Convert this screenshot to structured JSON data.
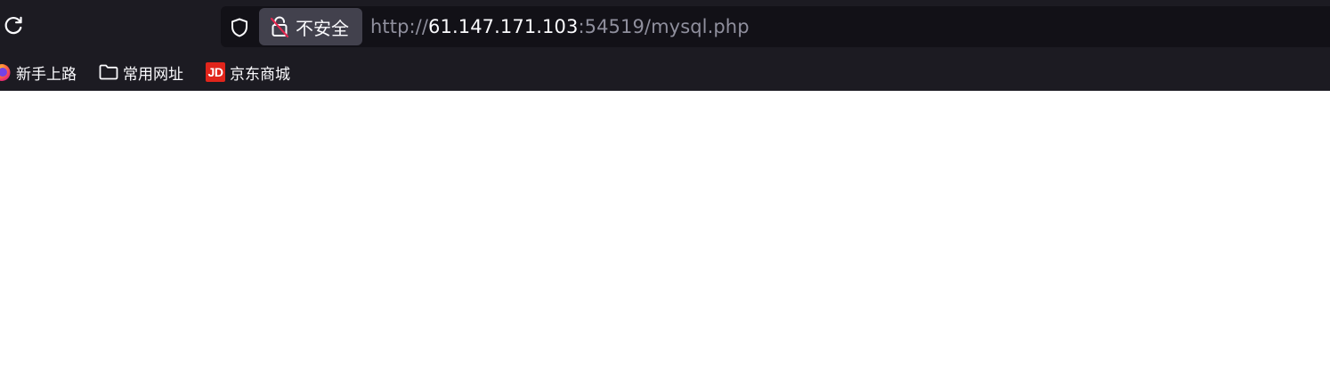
{
  "toolbar": {
    "reload_icon": "reload-icon"
  },
  "urlbar": {
    "shield_icon": "shield-icon",
    "insecure_label": "不安全",
    "insecure_icon": "insecure-lock-icon",
    "url_scheme": "http://",
    "url_host": "61.147.171.103",
    "url_rest": ":54519/mysql.php"
  },
  "bookmarks": {
    "items": [
      {
        "label": "新手上路",
        "icon": "firefox-icon"
      },
      {
        "label": "常用网址",
        "icon": "folder-icon"
      },
      {
        "label": "京东商城",
        "icon": "jd-icon",
        "logo_text": "JD"
      }
    ]
  },
  "colors": {
    "chrome_bg": "#1c1b22",
    "urlbar_bg": "#121117",
    "chip_bg": "#42414d",
    "text": "#fbfbfe",
    "muted_text": "#8f8f9d",
    "jd_red": "#e1251b",
    "page_bg": "#ffffff"
  }
}
